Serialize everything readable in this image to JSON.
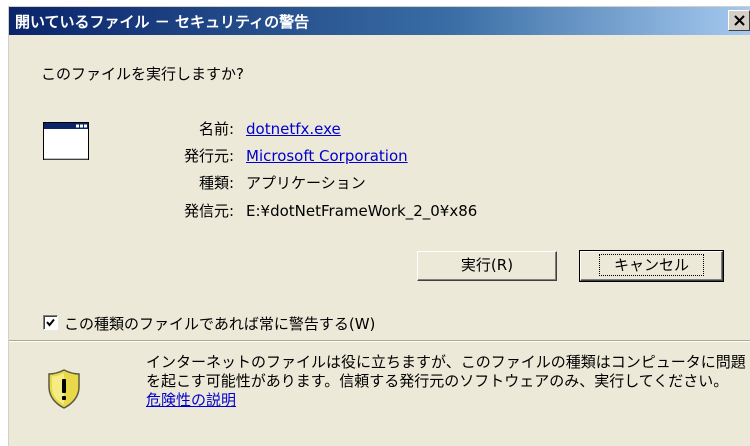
{
  "window": {
    "title": "開いているファイル － セキュリティの警告",
    "close_label": "×"
  },
  "question": "このファイルを実行しますか?",
  "file_info": {
    "name_label": "名前:",
    "name_value": "dotnetfx.exe",
    "publisher_label": "発行元:",
    "publisher_value": "Microsoft Corporation",
    "type_label": "種類:",
    "type_value": "アプリケーション",
    "from_label": "発信元:",
    "from_value": "E:¥dotNetFrameWork_2_0¥x86"
  },
  "buttons": {
    "run_label": "実行(R)",
    "cancel_label": "キャンセル"
  },
  "checkbox": {
    "label": "この種類のファイルであれば常に警告する(W)",
    "checked": true
  },
  "warning": {
    "text": "インターネットのファイルは役に立ちますが、このファイルの種類はコンピュータに問題を起こす可能性があります。信頼する発行元のソフトウェアのみ、実行してください。",
    "link_label": "危険性の説明"
  },
  "icons": {
    "file": "application-window-icon",
    "warning": "shield-warning-icon",
    "close": "close-icon",
    "check": "checkmark-icon"
  },
  "colors": {
    "title_start": "#0a246a",
    "title_end": "#a6caf0",
    "link": "#0000cc",
    "dialog_bg": "#ece9d8"
  }
}
